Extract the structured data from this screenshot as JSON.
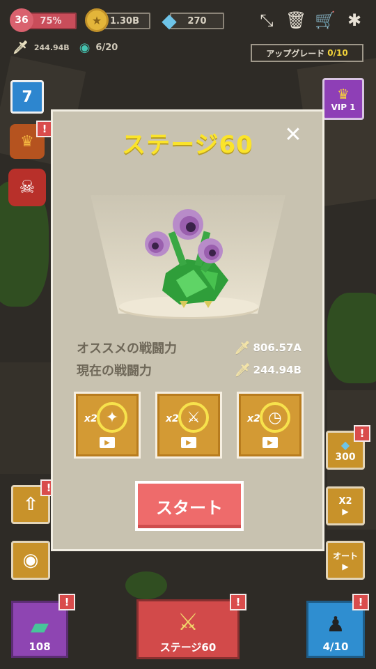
{
  "top": {
    "level": "36",
    "hp_percent": "75%",
    "coins": "1.30B",
    "gems": "270",
    "attack": "244.94B",
    "mask_count": "6/20"
  },
  "upgrade": {
    "label": "アップグレード",
    "count": "0/10"
  },
  "side": {
    "calendar_day": "7",
    "vip_label": "VIP 1",
    "gem_offer": "300",
    "x2_label": "X2",
    "auto_label": "オート"
  },
  "modal": {
    "title": "ステージ60",
    "recommended_label": "オススメの戦闘力",
    "recommended_value": "806.57A",
    "current_label": "現在の戦闘力",
    "current_value": "244.94B",
    "boosts": [
      {
        "multiplier": "x2",
        "icon": "break-icon"
      },
      {
        "multiplier": "x2",
        "icon": "sword-icon"
      },
      {
        "multiplier": "x2",
        "icon": "clock-icon"
      }
    ],
    "start_label": "スタート"
  },
  "bottom": {
    "inventory_count": "108",
    "stage_label": "ステージ60",
    "heroes_count": "4/10"
  },
  "colors": {
    "title": "#fbe42a",
    "start": "#ee6b6b",
    "boost": "#d39a34",
    "modal_bg": "#c8c2b0"
  }
}
